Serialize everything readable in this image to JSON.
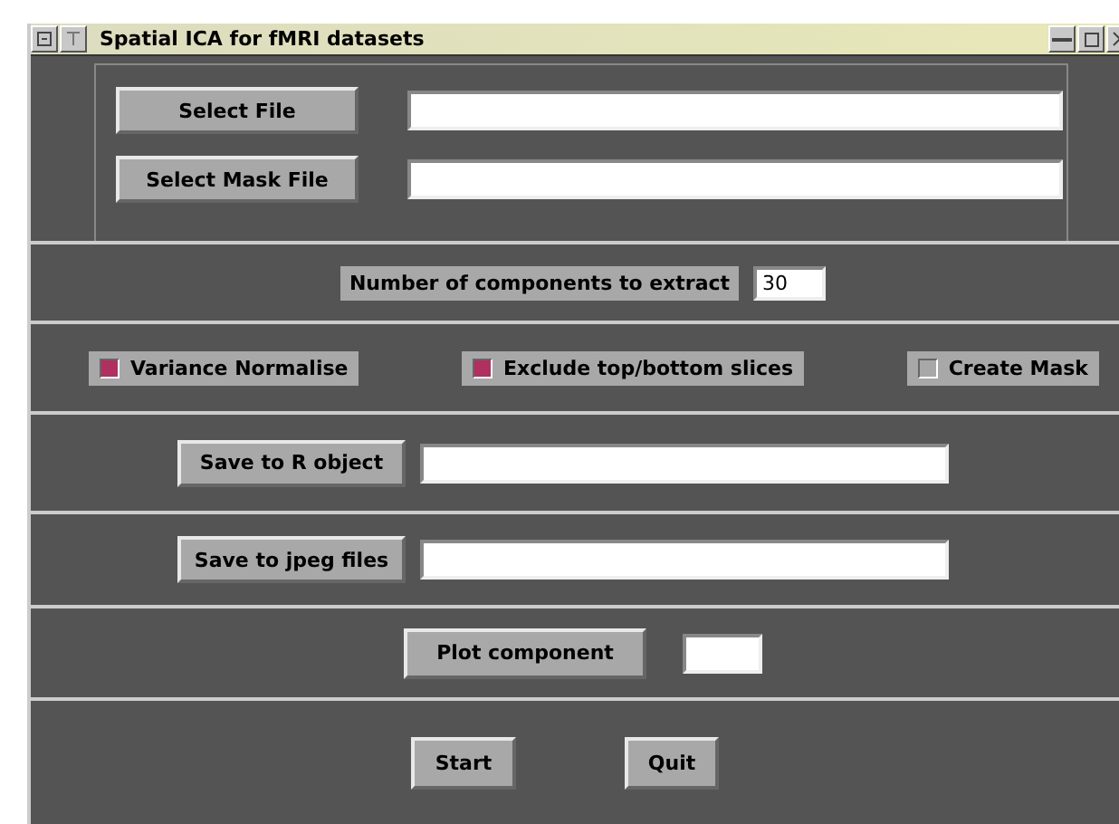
{
  "window": {
    "title": "Spatial ICA for fMRI datasets"
  },
  "file_rows": [
    {
      "button": "Select File"
    },
    {
      "button": "Select Mask File"
    }
  ],
  "components": {
    "label": "Number of components to extract",
    "value": "30"
  },
  "options": [
    {
      "label": "Variance Normalise",
      "checked": true
    },
    {
      "label": "Exclude top/bottom slices",
      "checked": true
    },
    {
      "label": "Create Mask",
      "checked": false
    }
  ],
  "save_rows": [
    {
      "button": "Save to R object"
    },
    {
      "button": "Save to jpeg files"
    }
  ],
  "plot": {
    "button": "Plot component"
  },
  "actions": [
    "Start",
    "Quit"
  ]
}
